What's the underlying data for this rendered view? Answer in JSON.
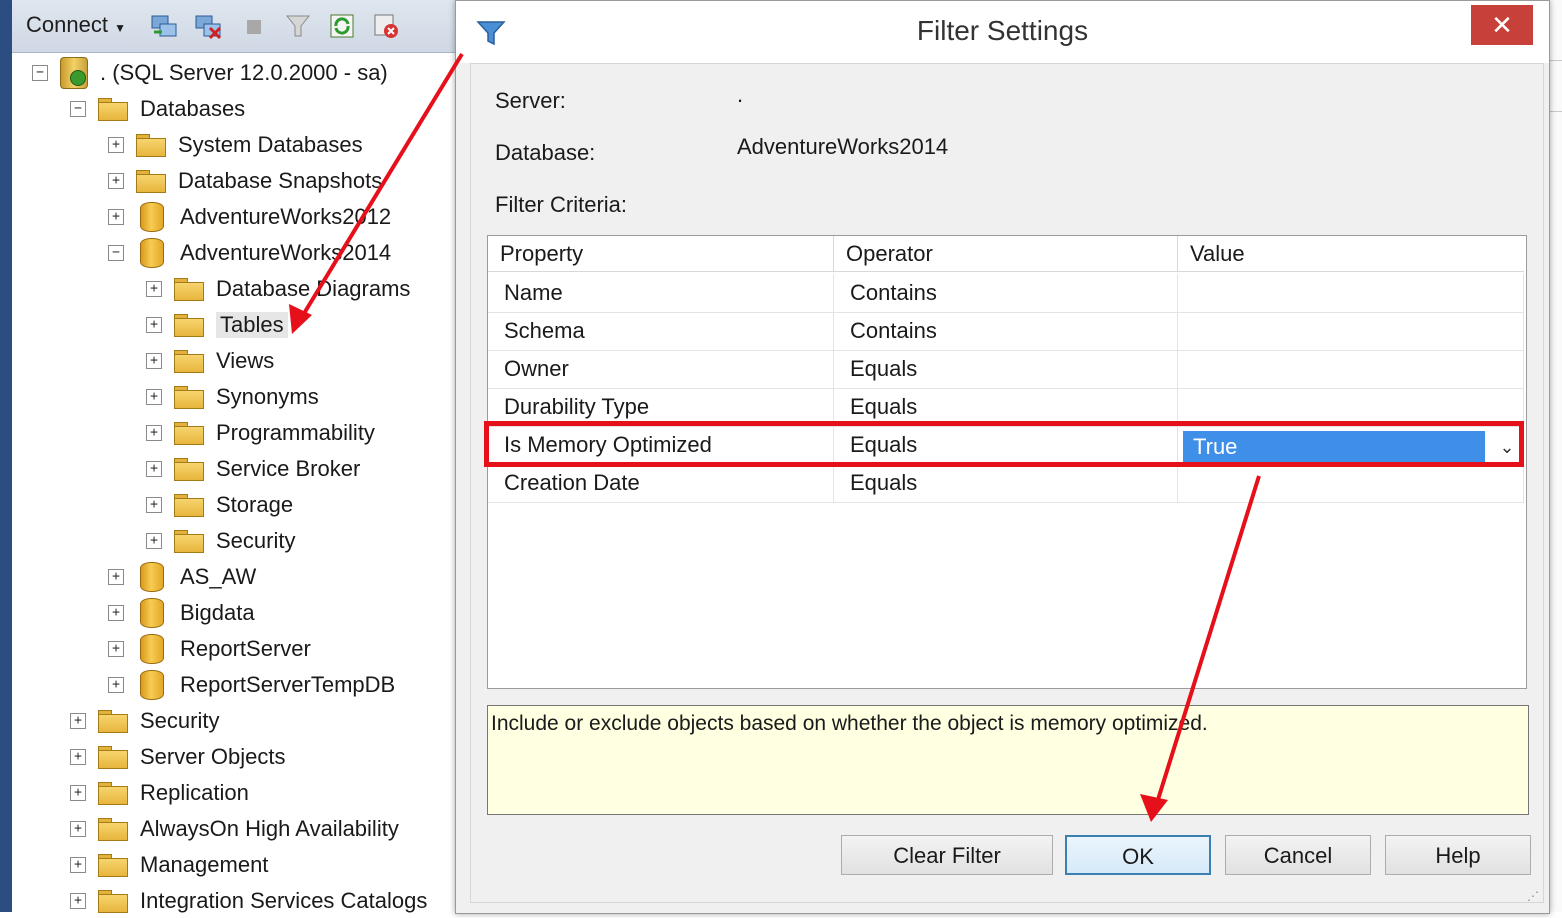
{
  "explorer": {
    "connect_label": "Connect",
    "toolbar_icons": [
      "connect-object-explorer-icon",
      "disconnect-icon",
      "stop-icon",
      "filter-icon",
      "refresh-icon",
      "delete-icon"
    ],
    "tree": [
      {
        "label": ". (SQL Server 12.0.2000 - sa)",
        "icon": "server-icon",
        "expander": "−",
        "level": 0
      },
      {
        "label": "Databases",
        "icon": "folder-icon",
        "expander": "−",
        "level": 1
      },
      {
        "label": "System Databases",
        "icon": "folder-icon",
        "expander": "+",
        "level": 2
      },
      {
        "label": "Database Snapshots",
        "icon": "folder-icon",
        "expander": "+",
        "level": 2
      },
      {
        "label": "AdventureWorks2012",
        "icon": "database-icon",
        "expander": "+",
        "level": 2
      },
      {
        "label": "AdventureWorks2014",
        "icon": "database-icon",
        "expander": "−",
        "level": 2
      },
      {
        "label": "Database Diagrams",
        "icon": "folder-icon",
        "expander": "+",
        "level": 3
      },
      {
        "label": "Tables",
        "icon": "folder-icon",
        "expander": "+",
        "level": 3
      },
      {
        "label": "Views",
        "icon": "folder-icon",
        "expander": "+",
        "level": 3
      },
      {
        "label": "Synonyms",
        "icon": "folder-icon",
        "expander": "+",
        "level": 3
      },
      {
        "label": "Programmability",
        "icon": "folder-icon",
        "expander": "+",
        "level": 3
      },
      {
        "label": "Service Broker",
        "icon": "folder-icon",
        "expander": "+",
        "level": 3
      },
      {
        "label": "Storage",
        "icon": "folder-icon",
        "expander": "+",
        "level": 3
      },
      {
        "label": "Security",
        "icon": "folder-icon",
        "expander": "+",
        "level": 3
      },
      {
        "label": "AS_AW",
        "icon": "database-icon",
        "expander": "+",
        "level": 2
      },
      {
        "label": "Bigdata",
        "icon": "database-icon",
        "expander": "+",
        "level": 2
      },
      {
        "label": "ReportServer",
        "icon": "database-icon",
        "expander": "+",
        "level": 2
      },
      {
        "label": "ReportServerTempDB",
        "icon": "database-icon",
        "expander": "+",
        "level": 2
      },
      {
        "label": "Security",
        "icon": "folder-icon",
        "expander": "+",
        "level": 1
      },
      {
        "label": "Server Objects",
        "icon": "folder-icon",
        "expander": "+",
        "level": 1
      },
      {
        "label": "Replication",
        "icon": "folder-icon",
        "expander": "+",
        "level": 1
      },
      {
        "label": "AlwaysOn High Availability",
        "icon": "folder-icon",
        "expander": "+",
        "level": 1
      },
      {
        "label": "Management",
        "icon": "folder-icon",
        "expander": "+",
        "level": 1
      },
      {
        "label": "Integration Services Catalogs",
        "icon": "folder-icon",
        "expander": "+",
        "level": 1
      }
    ]
  },
  "dialog": {
    "title": "Filter Settings",
    "close_glyph": "✕",
    "server_label": "Server:",
    "server_value": ".",
    "database_label": "Database:",
    "database_value": "AdventureWorks2014",
    "criteria_label": "Filter Criteria:",
    "grid": {
      "headers": [
        "Property",
        "Operator",
        "Value"
      ],
      "rows": [
        {
          "property": "Name",
          "operator": "Contains",
          "value": ""
        },
        {
          "property": "Schema",
          "operator": "Contains",
          "value": ""
        },
        {
          "property": "Owner",
          "operator": "Equals",
          "value": ""
        },
        {
          "property": "Durability Type",
          "operator": "Equals",
          "value": ""
        },
        {
          "property": "Is Memory Optimized",
          "operator": "Equals",
          "value": "True"
        },
        {
          "property": "Creation Date",
          "operator": "Equals",
          "value": ""
        }
      ]
    },
    "description": "Include or exclude objects based on whether the object is memory optimized.",
    "buttons": {
      "clear_filter": "Clear Filter",
      "ok": "OK",
      "cancel": "Cancel",
      "help": "Help"
    }
  },
  "colors": {
    "annotation_red": "#e5101a",
    "selection_blue": "#3f8fe8",
    "description_bg": "#ffffe1"
  }
}
